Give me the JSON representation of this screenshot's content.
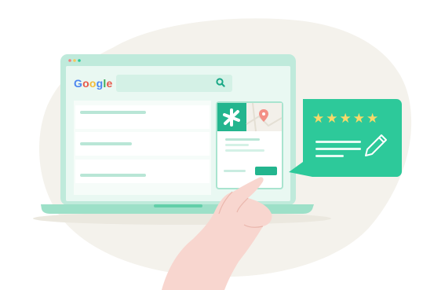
{
  "search": {
    "brand_text": "Google",
    "brand_letters": [
      {
        "char": "G",
        "color": "#4d86f0"
      },
      {
        "char": "o",
        "color": "#e8584b"
      },
      {
        "char": "o",
        "color": "#f3bb3b"
      },
      {
        "char": "g",
        "color": "#4d86f0"
      },
      {
        "char": "l",
        "color": "#3bab5b"
      },
      {
        "char": "e",
        "color": "#e8584b"
      }
    ],
    "search_icon": "magnifier-icon"
  },
  "results": {
    "count_shown": 3
  },
  "review_card": {
    "stars": "★★★★★",
    "rating": 5,
    "rating_max": 5,
    "icon": "pencil-icon"
  },
  "business_card": {
    "logo_icon": "asterisk-logo-icon",
    "map_icon": "map-pin-icon"
  },
  "colors": {
    "teal": "#2dc99a",
    "teal_dark": "#19a886",
    "screen_bg": "#e9f8f2",
    "laptop_frame": "#bfeadb",
    "blob": "#f4f2ec",
    "skin": "#f8d6cf",
    "star": "#f6d96a"
  }
}
